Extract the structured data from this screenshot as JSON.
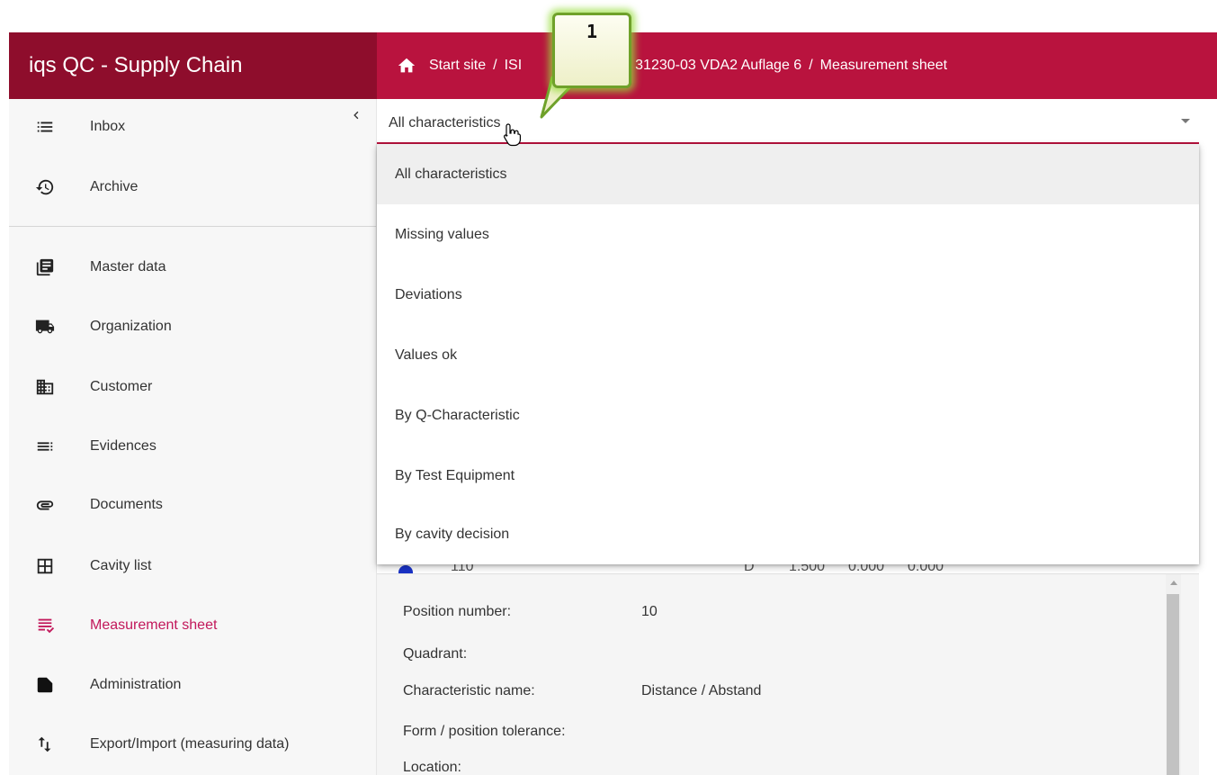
{
  "app": {
    "title": "iqs QC - Supply Chain"
  },
  "breadcrumb": {
    "items": [
      "Start site",
      "ISI",
      "31230-03 VDA2 Auflage 6",
      "Measurement sheet"
    ],
    "separator": "/"
  },
  "sidebar": {
    "items": [
      {
        "label": "Inbox",
        "icon": "list-icon"
      },
      {
        "label": "Archive",
        "icon": "history-icon"
      },
      {
        "label": "Master data",
        "icon": "library-books-icon"
      },
      {
        "label": "Organization",
        "icon": "truck-icon"
      },
      {
        "label": "Customer",
        "icon": "business-icon"
      },
      {
        "label": "Evidences",
        "icon": "subject-icon"
      },
      {
        "label": "Documents",
        "icon": "paperclip-icon"
      },
      {
        "label": "Cavity list",
        "icon": "grid-icon"
      },
      {
        "label": "Measurement sheet",
        "icon": "checklist-icon",
        "active": true
      },
      {
        "label": "Administration",
        "icon": "note-icon"
      },
      {
        "label": "Export/Import (measuring data)",
        "icon": "import-export-icon"
      }
    ],
    "collapse_icon": "chevron-left-icon"
  },
  "filter": {
    "selected": "All characteristics",
    "options": [
      "All characteristics",
      "Missing values",
      "Deviations",
      "Values ok",
      "By Q-Characteristic",
      "By Test Equipment",
      "By cavity decision"
    ]
  },
  "hidden_row": {
    "cells": [
      "110",
      "D",
      "1.500",
      "0.000",
      "0.000"
    ]
  },
  "details": {
    "rows": [
      {
        "label": "Position number:",
        "value": "10"
      },
      {
        "label": "Quadrant:",
        "value": ""
      },
      {
        "label": "Characteristic name:",
        "value": "Distance / Abstand"
      },
      {
        "label": "Form / position tolerance:",
        "value": ""
      },
      {
        "label": "Location:",
        "value": ""
      }
    ]
  },
  "callout": {
    "number": "1"
  },
  "colors": {
    "header": "#b9133e",
    "header_dark": "#8e0d2c",
    "active": "#c2185b",
    "callout_border": "#6fa12a"
  }
}
